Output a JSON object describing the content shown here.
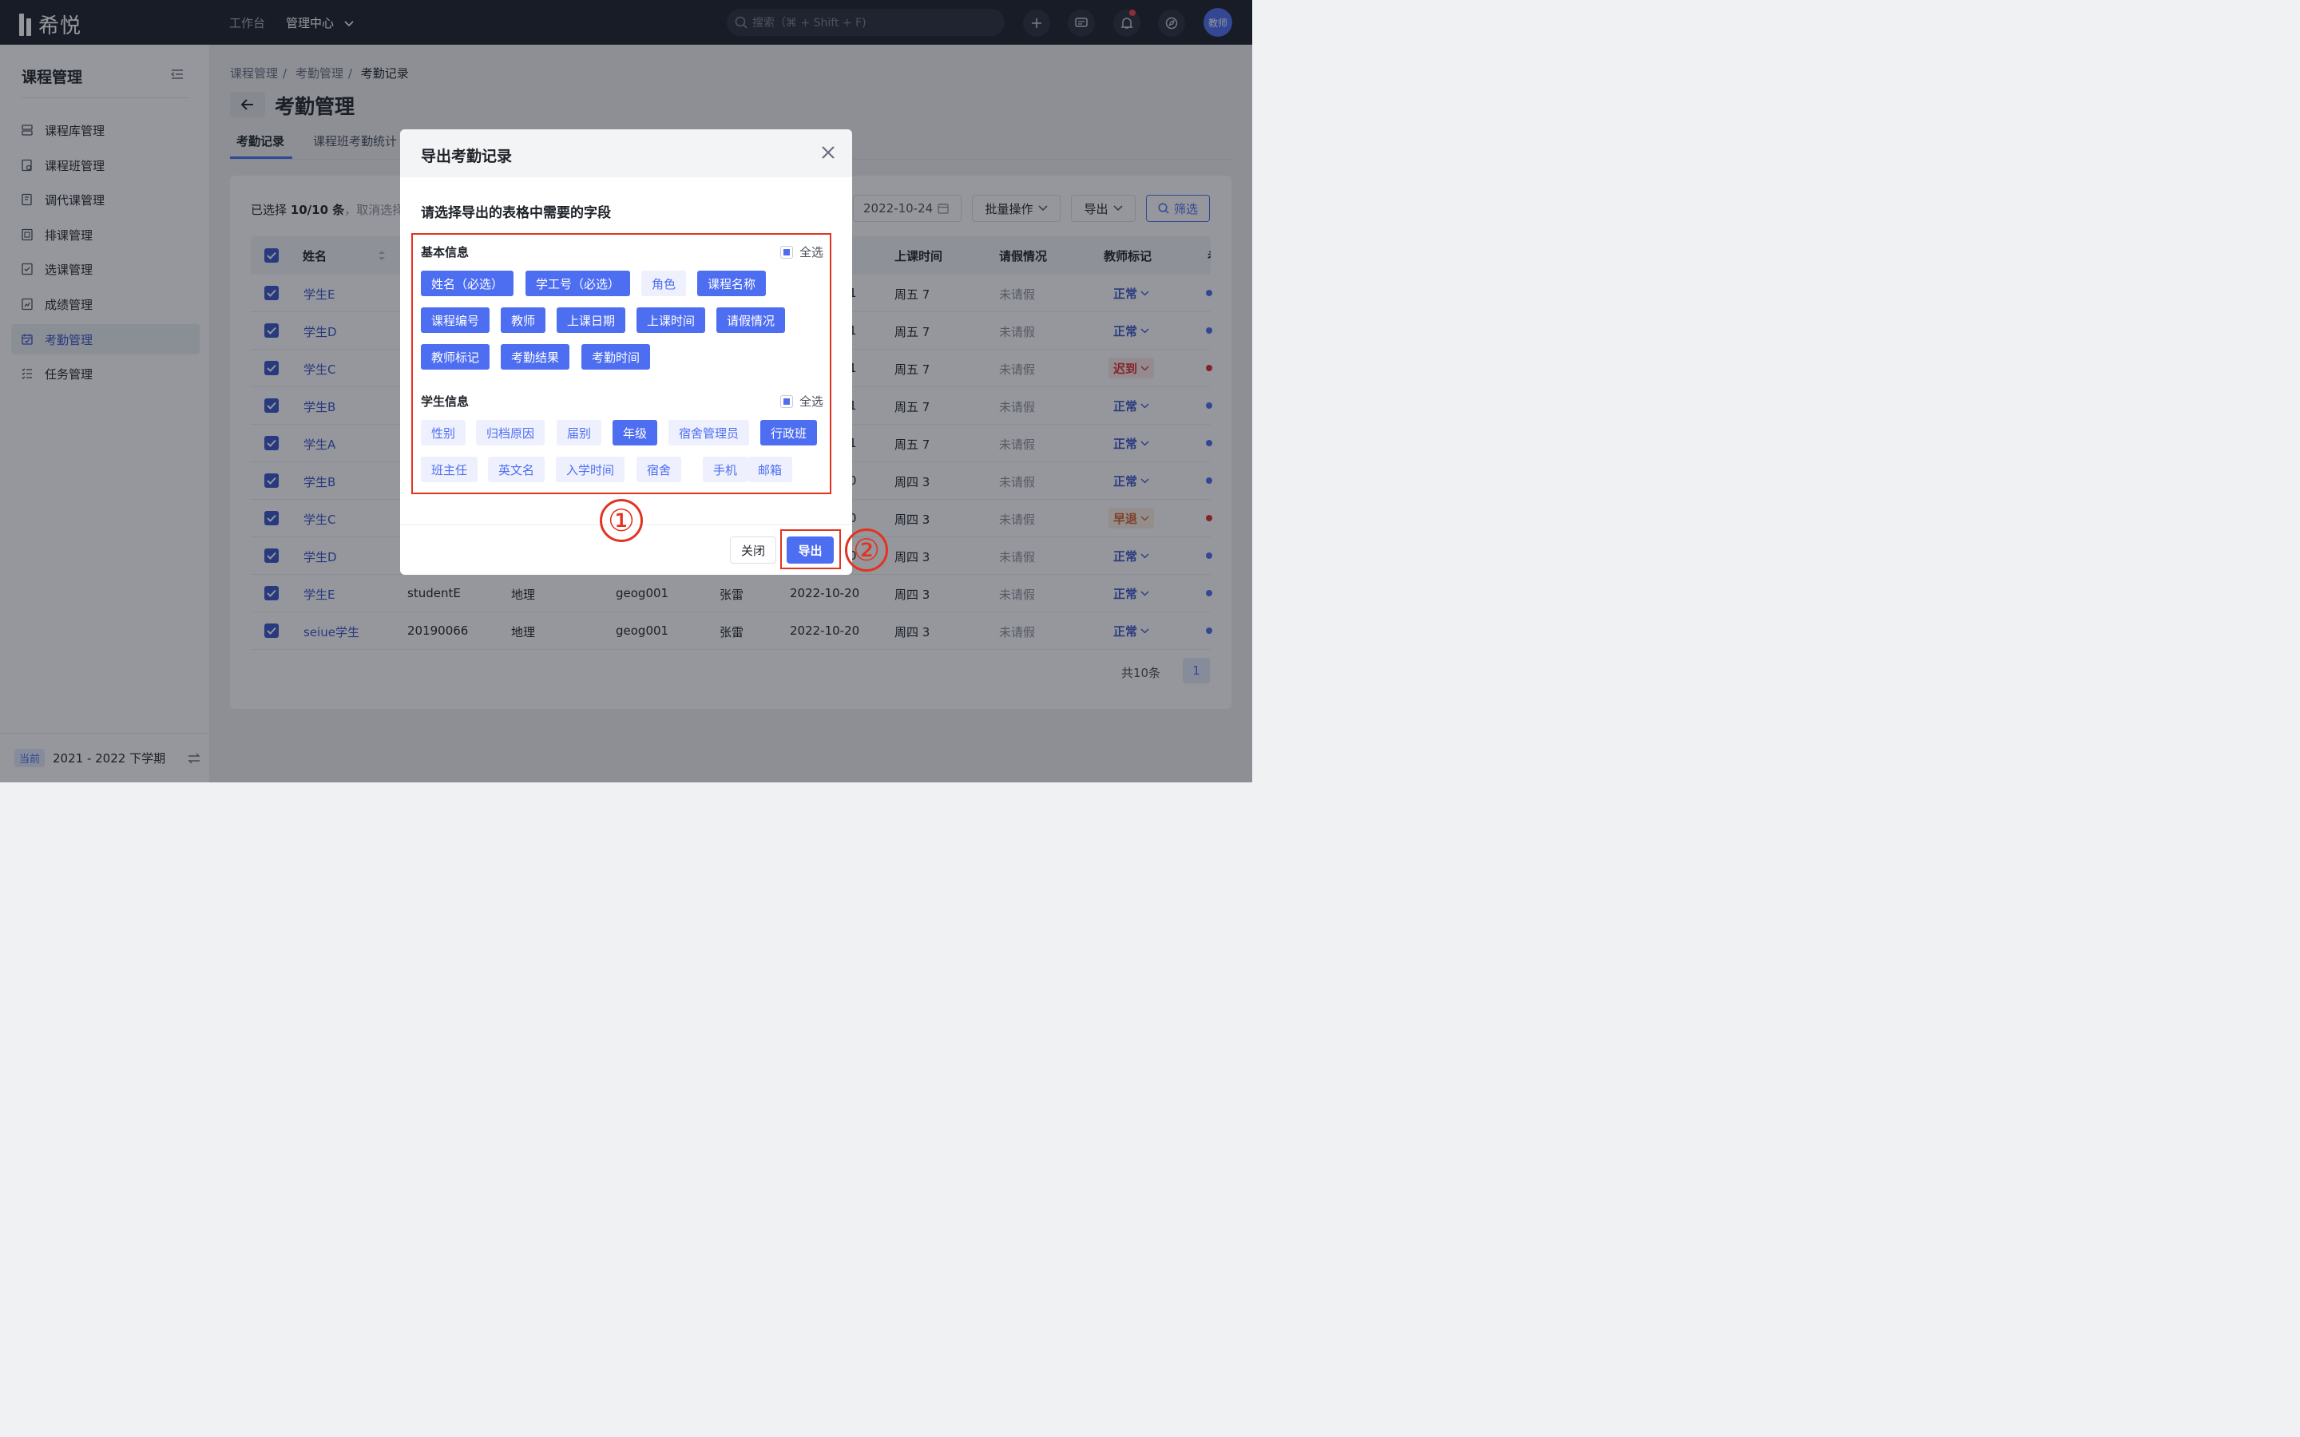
{
  "topbar": {
    "logo_text": "希悦",
    "nav_workbench": "工作台",
    "nav_admin": "管理中心",
    "search_placeholder": "搜索（⌘ + Shift + F)",
    "avatar_text": "教师"
  },
  "sidebar": {
    "title": "课程管理",
    "items": [
      {
        "label": "课程库管理",
        "icon": "course-library-icon"
      },
      {
        "label": "课程班管理",
        "icon": "course-class-icon"
      },
      {
        "label": "调代课管理",
        "icon": "substitute-icon"
      },
      {
        "label": "排课管理",
        "icon": "schedule-icon"
      },
      {
        "label": "选课管理",
        "icon": "course-selection-icon"
      },
      {
        "label": "成绩管理",
        "icon": "grades-icon"
      },
      {
        "label": "考勤管理",
        "icon": "attendance-icon",
        "active": true
      },
      {
        "label": "任务管理",
        "icon": "task-icon"
      }
    ],
    "term_badge": "当前",
    "term": "2021 - 2022 下学期"
  },
  "page": {
    "breadcrumb": [
      "课程管理",
      "考勤管理",
      "考勤记录"
    ],
    "title": "考勤管理",
    "tabs": [
      "考勤记录",
      "课程班考勤统计"
    ],
    "selection_prefix": "已选择",
    "selection_count": "10/10 条",
    "selection_cancel": "，取消选择",
    "date_value": "2022-10-24",
    "batch_label": "批量操作",
    "export_label": "导出",
    "filter_label": "筛选"
  },
  "table": {
    "headers": {
      "name": "姓名",
      "class_time": "上课时间",
      "leave": "请假情况",
      "teacher_mark": "教师标记",
      "extra": "考"
    },
    "rows": [
      {
        "name": "学生E",
        "date_tail": "1",
        "time": "周五 7",
        "leave": "未请假",
        "mark": "正常",
        "status": "ok"
      },
      {
        "name": "学生D",
        "date_tail": "1",
        "time": "周五 7",
        "leave": "未请假",
        "mark": "正常",
        "status": "ok"
      },
      {
        "name": "学生C",
        "date_tail": "1",
        "time": "周五 7",
        "leave": "未请假",
        "mark": "迟到",
        "status": "late"
      },
      {
        "name": "学生B",
        "date_tail": "1",
        "time": "周五 7",
        "leave": "未请假",
        "mark": "正常",
        "status": "ok"
      },
      {
        "name": "学生A",
        "date_tail": "1",
        "time": "周五 7",
        "leave": "未请假",
        "mark": "正常",
        "status": "ok"
      },
      {
        "name": "学生B",
        "date_tail": "0",
        "time": "周四 3",
        "leave": "未请假",
        "mark": "正常",
        "status": "ok"
      },
      {
        "name": "学生C",
        "date_tail": "0",
        "time": "周四 3",
        "leave": "未请假",
        "mark": "早退",
        "status": "early"
      },
      {
        "name": "学生D",
        "date_tail": "0",
        "time": "周四 3",
        "leave": "未请假",
        "mark": "正常",
        "status": "ok"
      },
      {
        "name": "学生E",
        "sid": "studentE",
        "subject": "地理",
        "code": "geog001",
        "teacher": "张雷",
        "date": "2022-10-20",
        "time": "周四 3",
        "leave": "未请假",
        "mark": "正常",
        "status": "ok"
      },
      {
        "name": "seiue学生",
        "sid": "20190066",
        "subject": "地理",
        "code": "geog001",
        "teacher": "张雷",
        "date": "2022-10-20",
        "time": "周四 3",
        "leave": "未请假",
        "mark": "正常",
        "status": "ok"
      }
    ],
    "total": "共10条",
    "current_page": "1"
  },
  "modal": {
    "title": "导出考勤记录",
    "subtitle": "请选择导出的表格中需要的字段",
    "basic_group": "基本信息",
    "student_group": "学生信息",
    "select_all": "全选",
    "basic_fields": [
      {
        "label": "姓名（必选）",
        "selected": true
      },
      {
        "label": "学工号（必选）",
        "selected": true
      },
      {
        "label": "角色",
        "selected": false
      },
      {
        "label": "课程名称",
        "selected": true
      },
      {
        "label": "课程编号",
        "selected": true
      },
      {
        "label": "教师",
        "selected": true
      },
      {
        "label": "上课日期",
        "selected": true
      },
      {
        "label": "上课时间",
        "selected": true
      },
      {
        "label": "请假情况",
        "selected": true
      },
      {
        "label": "教师标记",
        "selected": true
      },
      {
        "label": "考勤结果",
        "selected": true
      },
      {
        "label": "考勤时间",
        "selected": true
      }
    ],
    "student_fields": [
      {
        "label": "性别",
        "selected": false
      },
      {
        "label": "归档原因",
        "selected": false
      },
      {
        "label": "届别",
        "selected": false
      },
      {
        "label": "年级",
        "selected": true
      },
      {
        "label": "宿舍管理员",
        "selected": false
      },
      {
        "label": "行政班",
        "selected": true
      },
      {
        "label": "班主任",
        "selected": false
      },
      {
        "label": "英文名",
        "selected": false
      },
      {
        "label": "入学时间",
        "selected": false
      },
      {
        "label": "宿舍",
        "selected": false
      },
      {
        "label": "手机",
        "selected": false
      },
      {
        "label": "邮箱",
        "selected": false
      }
    ],
    "close_label": "关闭",
    "export_label": "导出"
  },
  "annotations": {
    "step1": "①",
    "step2": "②"
  },
  "colors": {
    "accent": "#4e6ef2",
    "annotation_red": "#e3331f",
    "topbar": "#1c1f2b"
  }
}
